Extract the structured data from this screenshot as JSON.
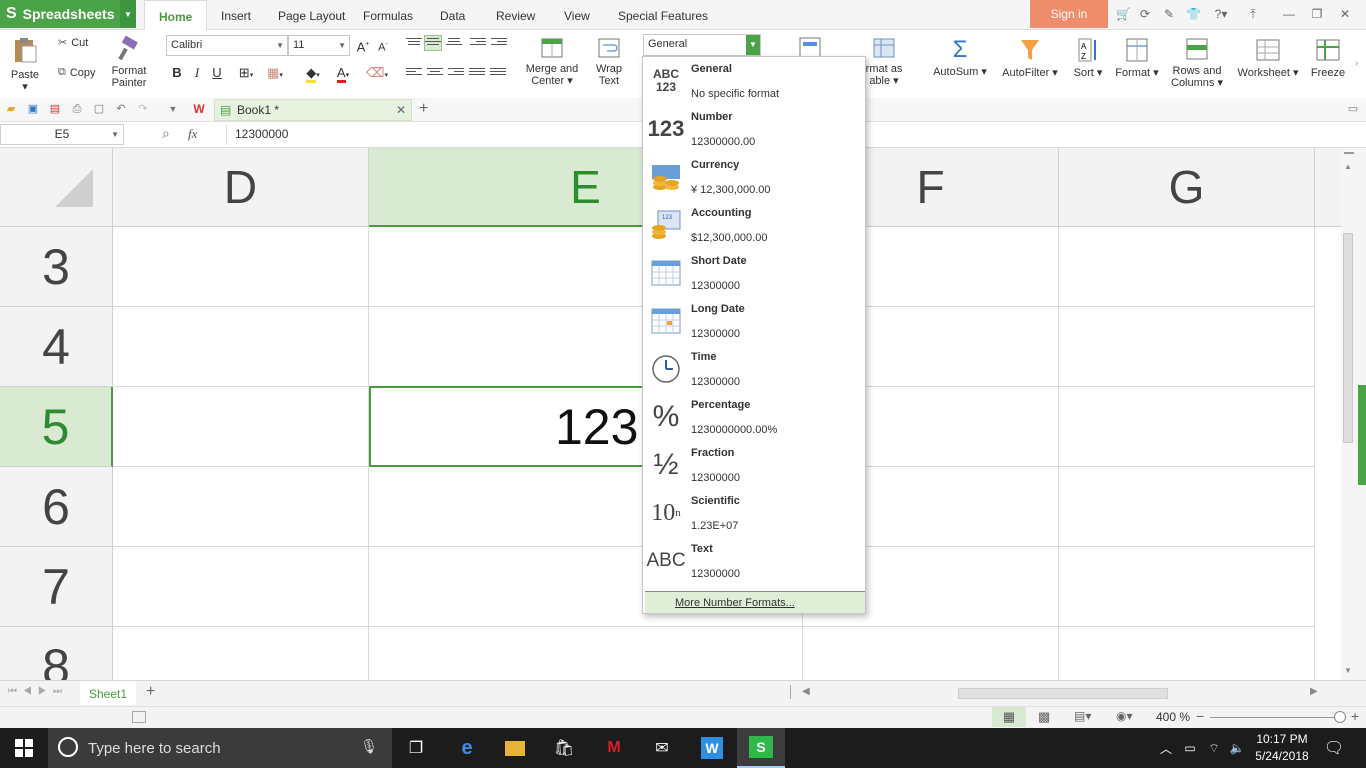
{
  "app": {
    "name": "Spreadsheets",
    "logo": "S"
  },
  "menu": {
    "tabs": [
      {
        "label": "Home"
      },
      {
        "label": "Insert"
      },
      {
        "label": "Page Layout"
      },
      {
        "label": "Formulas"
      },
      {
        "label": "Data"
      },
      {
        "label": "Review"
      },
      {
        "label": "View"
      },
      {
        "label": "Special Features"
      }
    ],
    "signin": "Sign in"
  },
  "ribbon": {
    "paste": "Paste",
    "cut": "Cut",
    "copy": "Copy",
    "format_painter_1": "Format",
    "format_painter_2": "Painter",
    "font_name": "Calibri",
    "font_size": "11",
    "bold": "B",
    "italic": "I",
    "underline": "U",
    "merge_1": "Merge and",
    "merge_2": "Center",
    "wrap_1": "Wrap",
    "wrap_2": "Text",
    "number_format": "General",
    "format_table_1": "rmat as",
    "format_table_2": "able",
    "autosum": "AutoSum",
    "autofilter": "AutoFilter",
    "sort": "Sort",
    "format": "Format",
    "rows_cols_1": "Rows and",
    "rows_cols_2": "Columns",
    "worksheet": "Worksheet",
    "freeze": "Freeze"
  },
  "document": {
    "tab_title": "Book1 *"
  },
  "formula_bar": {
    "cell_ref": "E5",
    "fx": "fx",
    "value": "12300000"
  },
  "grid": {
    "columns": [
      "D",
      "E",
      "F",
      "G"
    ],
    "rows": [
      "3",
      "4",
      "5",
      "6",
      "7",
      "8"
    ],
    "active_cell_display": "123"
  },
  "format_menu": {
    "items": [
      {
        "name": "General",
        "sample": "No specific format",
        "icon": "abc-123-icon"
      },
      {
        "name": "Number",
        "sample": "12300000.00",
        "icon": "number-123-icon"
      },
      {
        "name": "Currency",
        "sample": "¥ 12,300,000.00",
        "icon": "currency-coins-icon"
      },
      {
        "name": "Accounting",
        "sample": "$12,300,000.00",
        "icon": "accounting-icon"
      },
      {
        "name": "Short Date",
        "sample": "12300000",
        "icon": "calendar-icon"
      },
      {
        "name": "Long Date",
        "sample": "12300000",
        "icon": "calendar-icon"
      },
      {
        "name": "Time",
        "sample": "12300000",
        "icon": "clock-icon"
      },
      {
        "name": "Percentage",
        "sample": "1230000000.00%",
        "icon": "percent-icon"
      },
      {
        "name": "Fraction",
        "sample": "12300000",
        "icon": "fraction-icon"
      },
      {
        "name": "Scientific",
        "sample": "1.23E+07",
        "icon": "scientific-icon"
      },
      {
        "name": "Text",
        "sample": "12300000",
        "icon": "text-abc-icon"
      }
    ],
    "more": "More Number Formats...",
    "glyphs": {
      "general_top": "ABC",
      "general_bottom": "123",
      "number": "123",
      "accounting": "123",
      "percentage": "%",
      "fraction": "½",
      "scientific_base": "10",
      "scientific_exp": "n",
      "text": "ABC"
    }
  },
  "sheets": {
    "tabs": [
      "Sheet1"
    ]
  },
  "status": {
    "zoom": "400 %"
  },
  "taskbar": {
    "search_placeholder": "Type here to search",
    "time": "10:17 PM",
    "date": "5/24/2018",
    "app_tile_glyphs": {
      "wps_writer": "W",
      "wps_spreadsheets": "S"
    }
  },
  "colors": {
    "accent": "#4aa346",
    "signin": "#ee8c6b",
    "selected_header": "#d9ead3"
  }
}
